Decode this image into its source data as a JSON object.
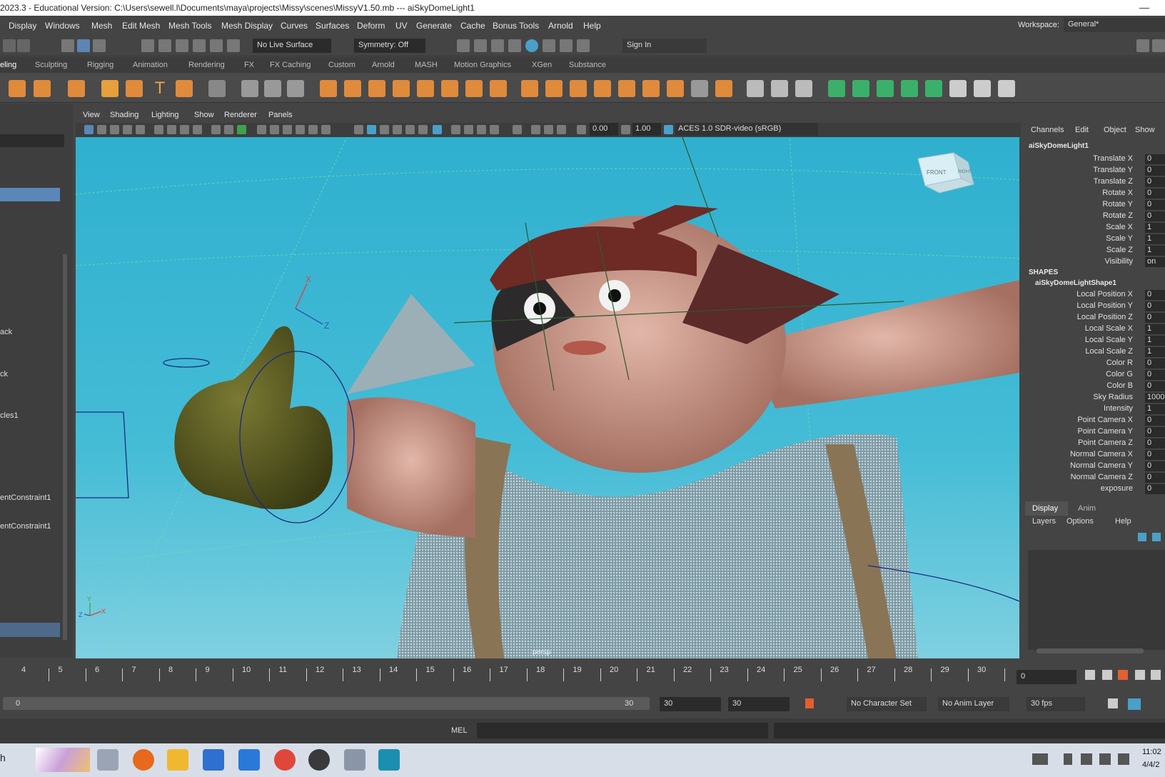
{
  "titlebar": {
    "title": "2023.3 - Educational Version: C:\\Users\\sewell.l\\Documents\\maya\\projects\\Missy\\scenes\\MissyV1.50.mb   ---   aiSkyDomeLight1",
    "minimize": "—"
  },
  "menubar": {
    "items": [
      "Display",
      "Windows",
      "Mesh",
      "Edit Mesh",
      "Mesh Tools",
      "Mesh Display",
      "Curves",
      "Surfaces",
      "Deform",
      "UV",
      "Generate",
      "Cache",
      "Bonus Tools",
      "Arnold",
      "Help"
    ],
    "workspace_label": "Workspace:",
    "workspace_value": "General*"
  },
  "statusline": {
    "live_surface": "No Live Surface",
    "symmetry": "Symmetry: Off",
    "sign_in": "Sign In"
  },
  "shelf_tabs": [
    "eling",
    "Sculpting",
    "Rigging",
    "Animation",
    "Rendering",
    "FX",
    "FX Caching",
    "Custom",
    "Arnold",
    "MASH",
    "Motion Graphics",
    "XGen",
    "Substance"
  ],
  "shelf_active_tab": "eling",
  "outliner": {
    "items": [
      "ack",
      "ck",
      "cles1",
      "entConstraint1",
      "entConstraint1"
    ]
  },
  "viewport": {
    "menus": [
      "View",
      "Shading",
      "Lighting",
      "Show",
      "Renderer",
      "Panels"
    ],
    "field_a": "0.00",
    "field_b": "1.00",
    "color_space": "ACES 1.0 SDR-video (sRGB)",
    "camera_label": "persp",
    "viewcube_front": "FRONT",
    "viewcube_right": "RIGHT",
    "axis_x": "X",
    "axis_y": "Y",
    "axis_z": "Z"
  },
  "channelbox": {
    "menus": [
      "Channels",
      "Edit",
      "Object",
      "Show"
    ],
    "node": "aiSkyDomeLight1",
    "attrs": [
      {
        "name": "Translate X",
        "value": "0"
      },
      {
        "name": "Translate Y",
        "value": "0"
      },
      {
        "name": "Translate Z",
        "value": "0"
      },
      {
        "name": "Rotate X",
        "value": "0"
      },
      {
        "name": "Rotate Y",
        "value": "0"
      },
      {
        "name": "Rotate Z",
        "value": "0"
      },
      {
        "name": "Scale X",
        "value": "1"
      },
      {
        "name": "Scale Y",
        "value": "1"
      },
      {
        "name": "Scale Z",
        "value": "1"
      },
      {
        "name": "Visibility",
        "value": "on"
      }
    ],
    "shapes_label": "SHAPES",
    "shape_node": "aiSkyDomeLightShape1",
    "shape_attrs": [
      {
        "name": "Local Position X",
        "value": "0"
      },
      {
        "name": "Local Position Y",
        "value": "0"
      },
      {
        "name": "Local Position Z",
        "value": "0"
      },
      {
        "name": "Local Scale X",
        "value": "1"
      },
      {
        "name": "Local Scale Y",
        "value": "1"
      },
      {
        "name": "Local Scale Z",
        "value": "1"
      },
      {
        "name": "Color R",
        "value": "0"
      },
      {
        "name": "Color G",
        "value": "0"
      },
      {
        "name": "Color B",
        "value": "0"
      },
      {
        "name": "Sky Radius",
        "value": "1000"
      },
      {
        "name": "Intensity",
        "value": "1"
      },
      {
        "name": "Point Camera X",
        "value": "0"
      },
      {
        "name": "Point Camera Y",
        "value": "0"
      },
      {
        "name": "Point Camera Z",
        "value": "0"
      },
      {
        "name": "Normal Camera X",
        "value": "0"
      },
      {
        "name": "Normal Camera Y",
        "value": "0"
      },
      {
        "name": "Normal Camera Z",
        "value": "0"
      },
      {
        "name": "exposure",
        "value": "0"
      }
    ]
  },
  "layers": {
    "tabs": [
      "Display",
      "Anim"
    ],
    "menus": [
      "Layers",
      "Options",
      "Help"
    ]
  },
  "timeline": {
    "ticks": [
      "4",
      "5",
      "6",
      "7",
      "8",
      "9",
      "10",
      "11",
      "12",
      "13",
      "14",
      "15",
      "16",
      "17",
      "18",
      "19",
      "20",
      "21",
      "22",
      "23",
      "24",
      "25",
      "26",
      "27",
      "28",
      "29",
      "30"
    ],
    "current_frame": "0"
  },
  "range": {
    "start": "0",
    "end": "30",
    "field1": "30",
    "field2": "30",
    "character_set": "No Character Set",
    "anim_layer": "No Anim Layer",
    "fps": "30 fps"
  },
  "cmdline": {
    "label": "MEL"
  },
  "taskbar": {
    "search_fragment": "h",
    "time": "11:02",
    "date": "4/4/2"
  }
}
